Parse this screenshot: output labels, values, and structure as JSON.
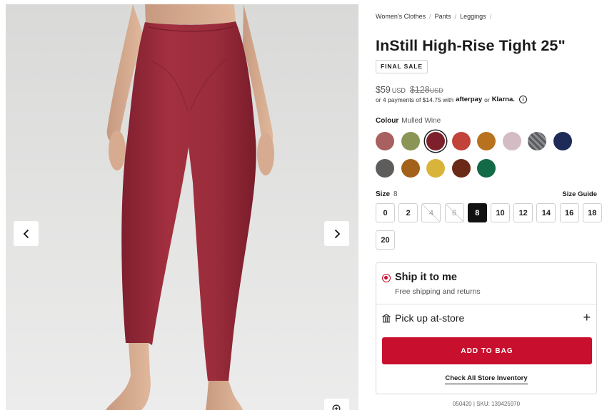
{
  "breadcrumb": [
    "Women's Clothes",
    "Pants",
    "Leggings"
  ],
  "product": {
    "title": "InStill High-Rise Tight 25\"",
    "badge": "FINAL SALE",
    "price": "$59",
    "currency": "USD",
    "original_price": "$128",
    "original_currency": "USD",
    "installments": {
      "text": "or 4 payments of $14.75 with",
      "afterpay": "afterpay",
      "or": "or",
      "klarna": "Klarna.",
      "info_icon": "i"
    }
  },
  "colour": {
    "label": "Colour",
    "value": "Mulled Wine",
    "swatches": [
      {
        "color": "#a86060",
        "selected": false
      },
      {
        "color": "#8a9556",
        "selected": false
      },
      {
        "color": "#7e1f2c",
        "selected": true
      },
      {
        "color": "#c2433a",
        "selected": false
      },
      {
        "color": "#b8721f",
        "selected": false
      },
      {
        "color": "#d3bcc3",
        "selected": false
      },
      {
        "color": "#5a5b5f",
        "selected": false,
        "pattern": true
      },
      {
        "color": "#1e2a57",
        "selected": false
      },
      {
        "color": "#5f5d5c",
        "selected": false
      },
      {
        "color": "#a3611a",
        "selected": false
      },
      {
        "color": "#d9b43a",
        "selected": false
      },
      {
        "color": "#6a2a17",
        "selected": false
      },
      {
        "color": "#136a46",
        "selected": false
      }
    ]
  },
  "size": {
    "label": "Size",
    "value": "8",
    "guide": "Size Guide",
    "options": [
      {
        "label": "0",
        "state": "available"
      },
      {
        "label": "2",
        "state": "available"
      },
      {
        "label": "4",
        "state": "unavailable"
      },
      {
        "label": "6",
        "state": "unavailable"
      },
      {
        "label": "8",
        "state": "selected"
      },
      {
        "label": "10",
        "state": "available"
      },
      {
        "label": "12",
        "state": "available"
      },
      {
        "label": "14",
        "state": "available"
      },
      {
        "label": "16",
        "state": "available"
      },
      {
        "label": "18",
        "state": "available"
      },
      {
        "label": "20",
        "state": "available"
      }
    ]
  },
  "fulfillment": {
    "ship_title": "Ship it to me",
    "ship_subtitle": "Free shipping and returns",
    "pickup_label": "Pick up at-store",
    "add_to_bag": "ADD TO BAG",
    "check_inventory": "Check All Store Inventory"
  },
  "sku": "050420 | SKU: 139425970",
  "colors": {
    "accent": "#c8102e",
    "product": "#9b2a3b"
  },
  "icons": {
    "prev": "chevron-left-icon",
    "next": "chevron-right-icon",
    "zoom": "zoom-in-icon",
    "store": "store-icon",
    "plus": "plus-icon",
    "info": "info-icon"
  }
}
